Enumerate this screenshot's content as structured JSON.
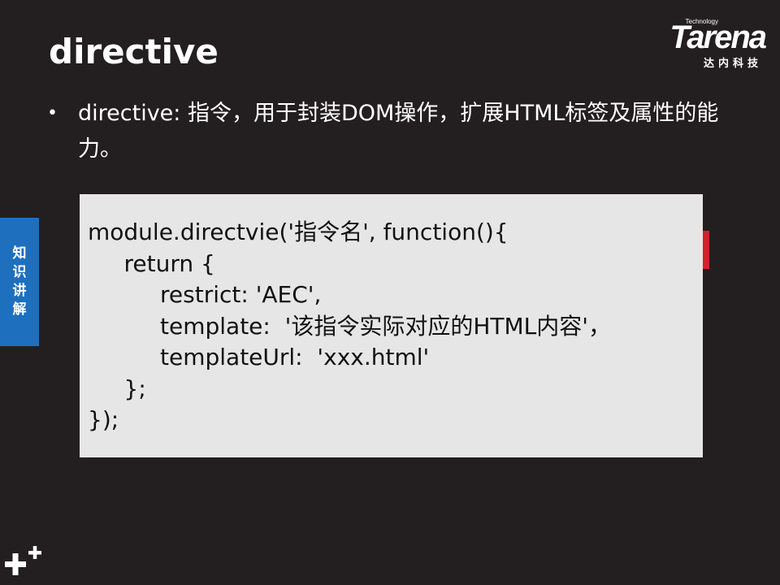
{
  "slide": {
    "title": "directive",
    "logo": {
      "tagline": "Technology",
      "word": "Tarena",
      "chinese": "达内科技"
    },
    "bullet": {
      "marker": "•",
      "text": "directive: 指令，用于封装DOM操作，扩展HTML标签及属性的能力。"
    },
    "side_tab": {
      "chars": [
        "知",
        "识",
        "讲",
        "解"
      ]
    },
    "code": {
      "lines": [
        "module.directvie('指令名', function(){",
        "     return {",
        "          restrict: 'AEC',",
        "          template:  '该指令实际对应的HTML内容'，",
        "          templateUrl:  'xxx.html'",
        "     };",
        "});"
      ]
    },
    "colors": {
      "background": "#231f20",
      "side_tab": "#1f6fbf",
      "accent_red": "#d2232a",
      "code_bg": "#e6e6e6"
    },
    "icons": {
      "corner": "plus-cluster-icon"
    }
  }
}
